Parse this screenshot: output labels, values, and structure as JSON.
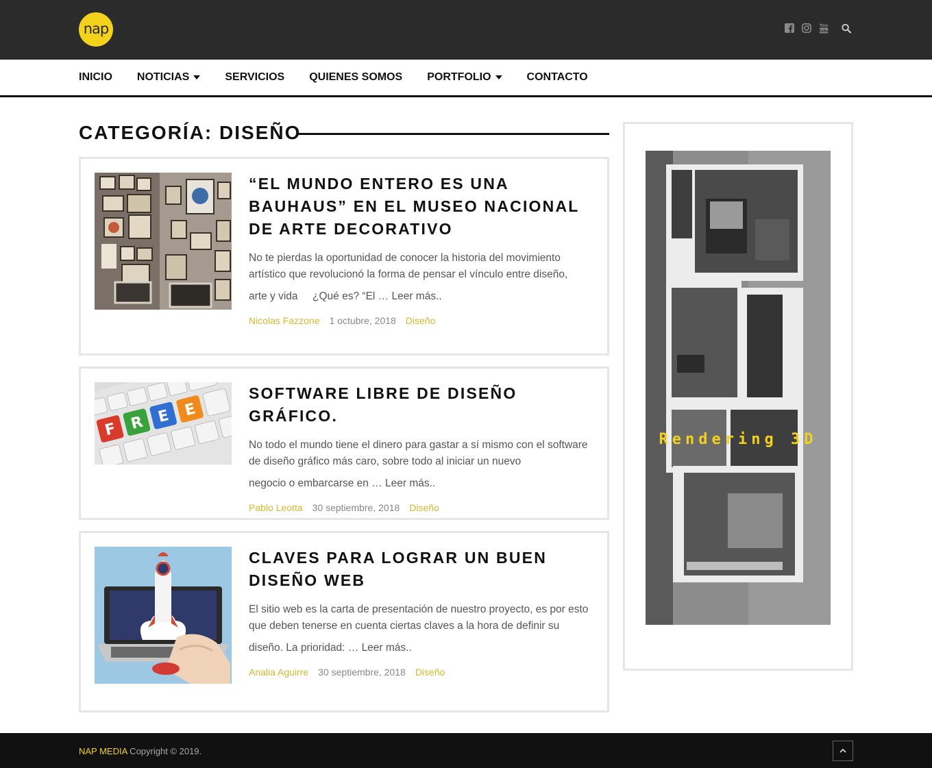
{
  "header": {
    "logo_text": "nap",
    "socials": [
      {
        "icon": "facebook-icon"
      },
      {
        "icon": "instagram-icon"
      },
      {
        "icon": "youtube-icon"
      },
      {
        "icon": "search-icon"
      }
    ]
  },
  "nav": {
    "items": [
      {
        "label": "INICIO"
      },
      {
        "label": "NOTICIAS",
        "dropdown": true
      },
      {
        "label": "SERVICIOS"
      },
      {
        "label": "QUIENES SOMOS"
      },
      {
        "label": "PORTFOLIO",
        "dropdown": true
      },
      {
        "label": "CONTACTO"
      }
    ]
  },
  "category": {
    "title": "CATEGORÍA: DISEÑO"
  },
  "posts": [
    {
      "title": "“EL MUNDO ENTERO ES UNA BAUHAUS” EN EL MUSEO NACIONAL DE ARTE DECORATIVO",
      "excerpt_1": "No te pierdas la oportunidad de conocer la historia del movimiento artístico que revolucionó la forma de pensar el vínculo entre diseño,",
      "excerpt_2": "arte y vida     ¿Qué es? “El … Leer más..",
      "author": "Nicolas Fazzone",
      "date": "1 octubre, 2018",
      "category": "Diseño"
    },
    {
      "title": "SOFTWARE LIBRE DE DISEÑO GRÁFICO.",
      "excerpt_1": "No todo el mundo tiene el dinero para gastar a sí mismo con el software de diseño gráfico más caro, sobre todo al iniciar un nuevo",
      "excerpt_2": "negocio o embarcarse en … Leer más..",
      "author": "Pablo Leotta",
      "date": "30 septiembre, 2018",
      "category": "Diseño"
    },
    {
      "title": "CLAVES PARA LOGRAR UN BUEN DISEÑO WEB",
      "excerpt_1": "El sitio web es la carta de presentación de nuestro proyecto, es por esto que deben tenerse en cuenta ciertas claves a la hora de definir su",
      "excerpt_2": "diseño. La prioridad: … Leer más..",
      "author": "Analia Aguirre",
      "date": "30 septiembre, 2018",
      "category": "Diseño"
    }
  ],
  "sidebar": {
    "banner_text": "Rendering 3D"
  },
  "footer": {
    "brand": "NAP MEDIA",
    "copyright": " Copyright © 2019."
  },
  "colors": {
    "accent": "#f2d21b",
    "meta_link": "#d4b92f",
    "topbar": "#2b2b2b",
    "footer": "#111111"
  }
}
